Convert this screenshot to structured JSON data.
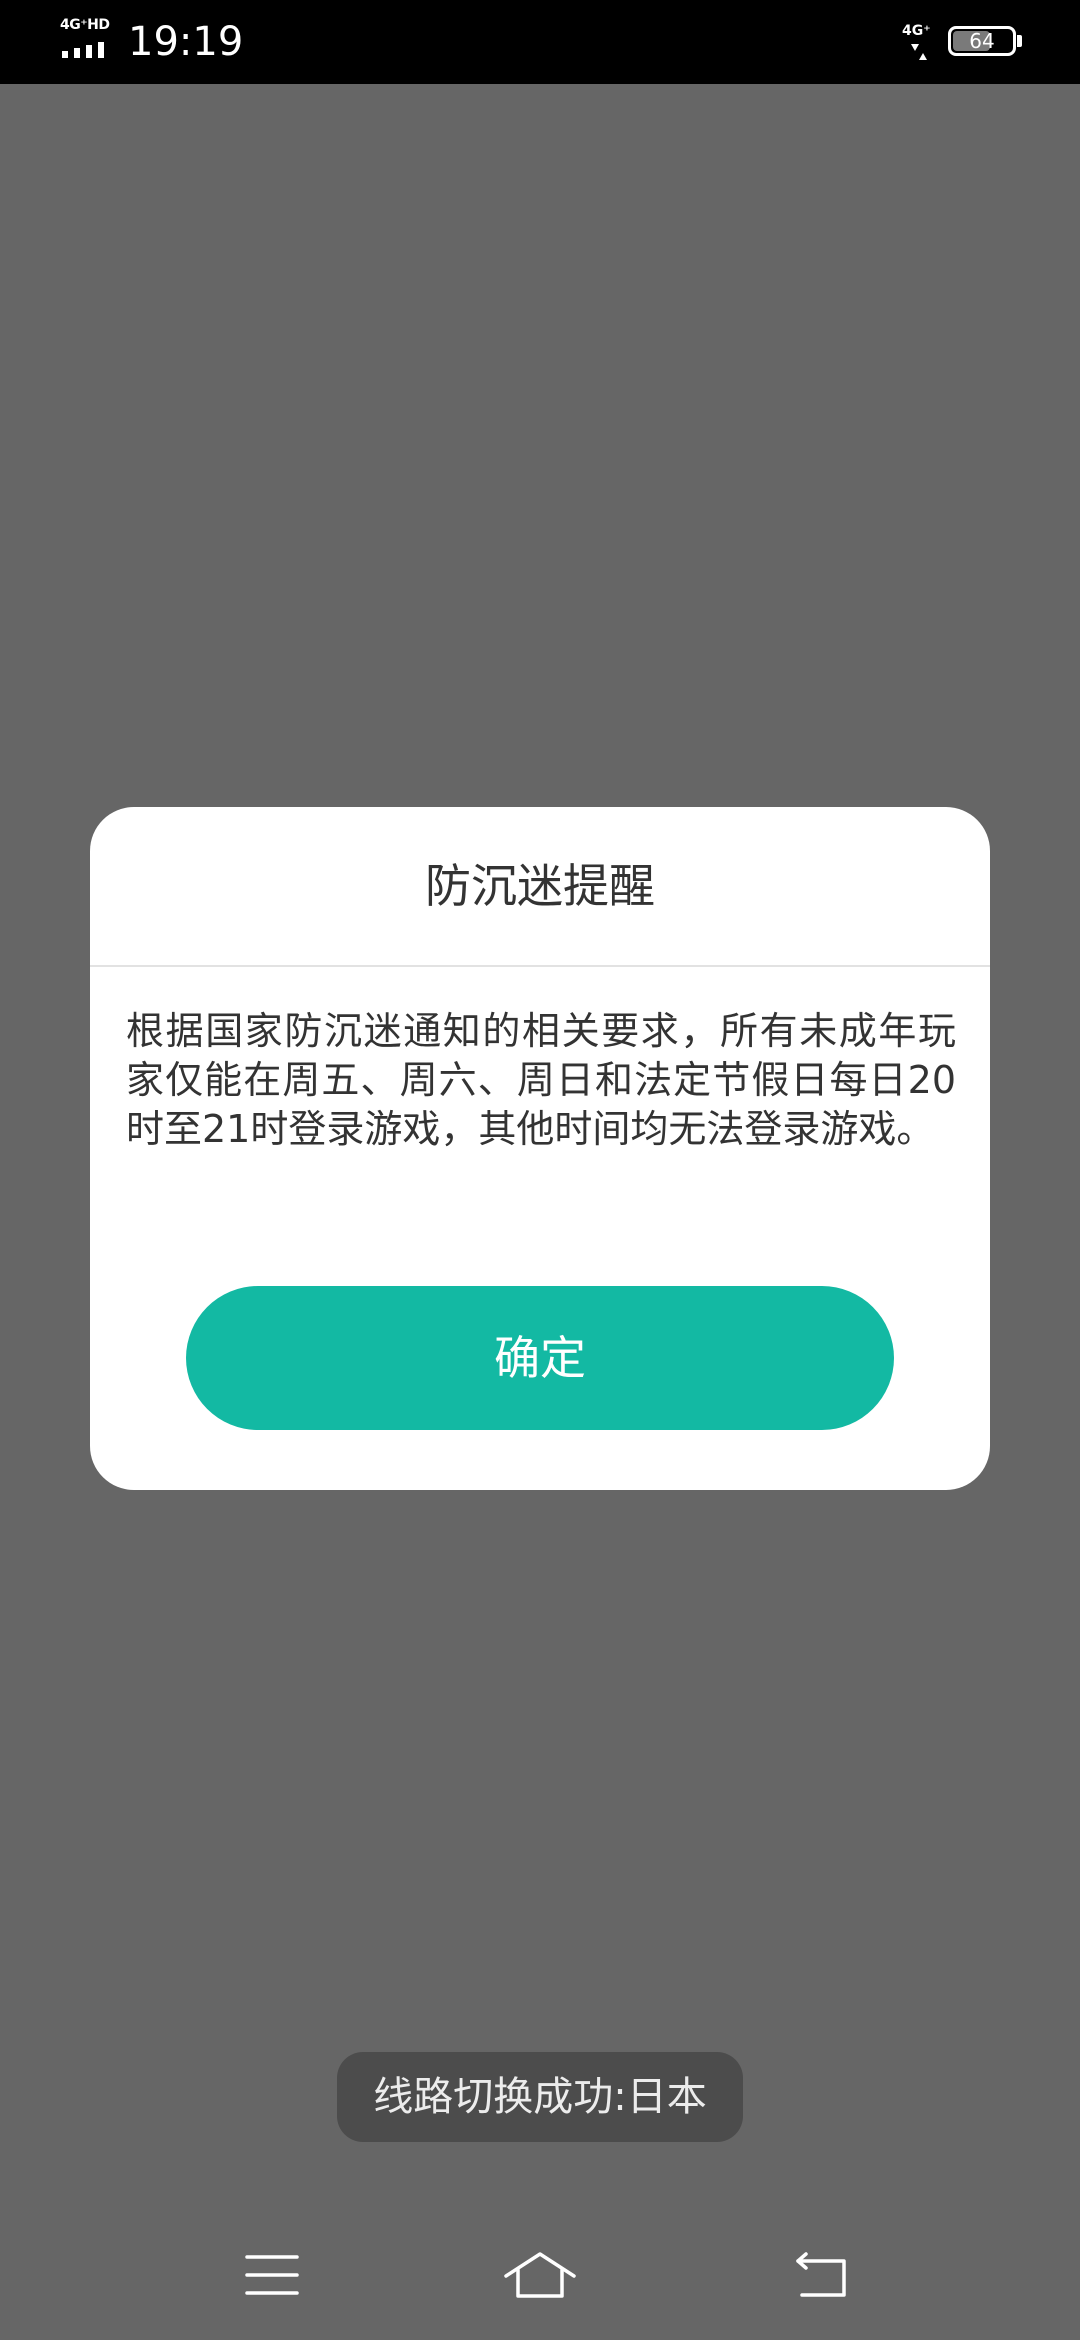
{
  "status_bar": {
    "network_left": "4G⁺HD",
    "time": "19:19",
    "network_right": "4G⁺",
    "battery_percent": "64",
    "battery_level": 0.64
  },
  "dialog": {
    "title": "防沉迷提醒",
    "message": "根据国家防沉迷通知的相关要求，所有未成年玩家仅能在周五、周六、周日和法定节假日每日20时至21时登录游戏，其他时间均无法登录游戏。",
    "confirm_label": "确定",
    "accent_color": "#13b9a3"
  },
  "toast": {
    "text": "线路切换成功:日本"
  },
  "nav_bar": {
    "icons": [
      "menu-icon",
      "home-icon",
      "back-icon"
    ]
  }
}
